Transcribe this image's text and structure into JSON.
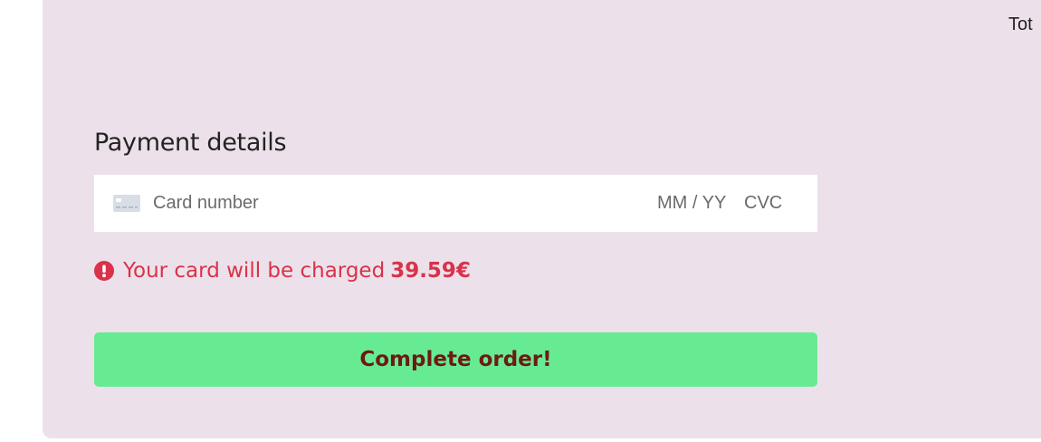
{
  "header": {
    "total_label": "Tot"
  },
  "payment": {
    "title": "Payment details",
    "card_number_placeholder": "Card number",
    "expiry_placeholder": "MM / YY",
    "cvc_placeholder": "CVC"
  },
  "notice": {
    "prefix": "Your card will be charged",
    "amount": "39.59€",
    "color": "#d9324a"
  },
  "actions": {
    "complete_label": "Complete order!",
    "button_color": "#66eb93"
  },
  "icons": {
    "card": "credit-card-icon",
    "notice": "exclamation-circle-icon"
  }
}
